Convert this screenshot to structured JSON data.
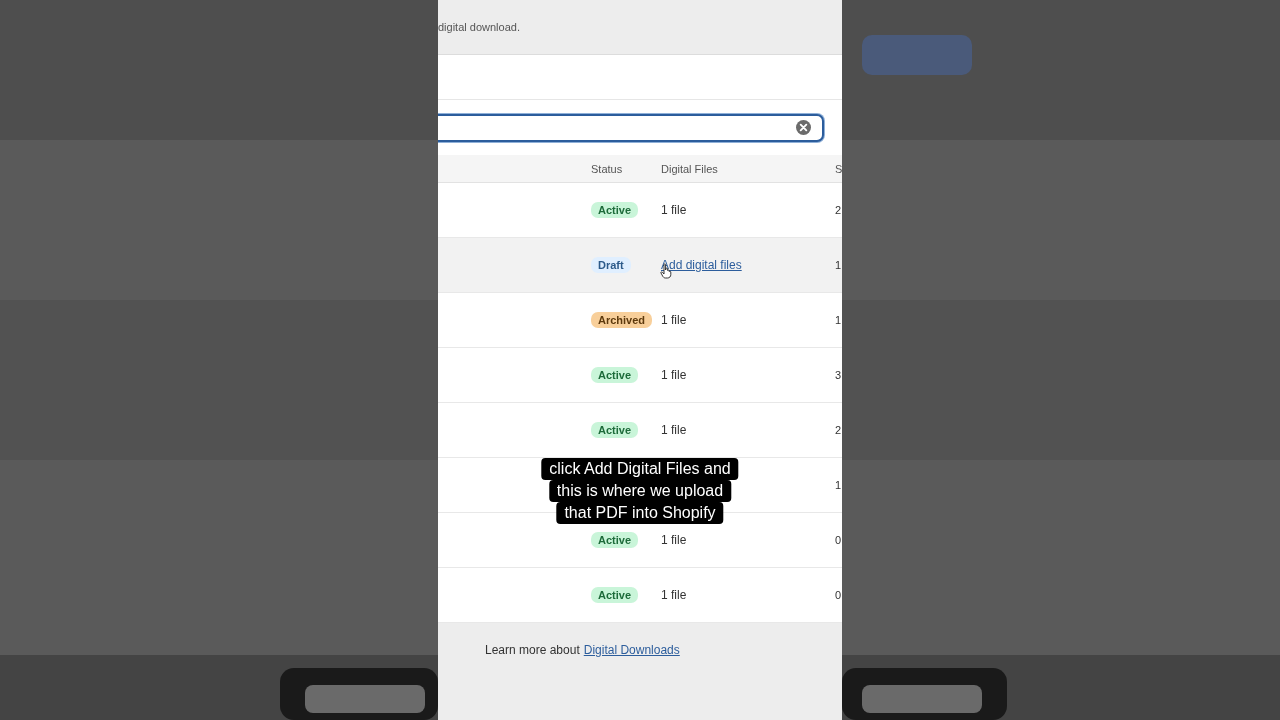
{
  "intro": {
    "text": "digital download."
  },
  "table": {
    "columns": [
      "Status",
      "Digital Files",
      "S"
    ],
    "rows": [
      {
        "status": {
          "label": "Active",
          "kind": "active"
        },
        "files": {
          "text": "1 file",
          "kind": "count"
        },
        "column_3": "2",
        "hovered": false
      },
      {
        "status": {
          "label": "Draft",
          "kind": "draft"
        },
        "files": {
          "text": "Add digital files",
          "kind": "link"
        },
        "column_3": "1",
        "hovered": true
      },
      {
        "status": {
          "label": "Archived",
          "kind": "archived"
        },
        "files": {
          "text": "1 file",
          "kind": "count"
        },
        "column_3": "1",
        "hovered": false
      },
      {
        "status": {
          "label": "Active",
          "kind": "active"
        },
        "files": {
          "text": "1 file",
          "kind": "count"
        },
        "column_3": "3",
        "hovered": false
      },
      {
        "status": {
          "label": "Active",
          "kind": "active"
        },
        "files": {
          "text": "1 file",
          "kind": "count"
        },
        "column_3": "2",
        "hovered": false
      },
      {
        "column_3": "1",
        "hovered": false
      },
      {
        "status": {
          "label": "Active",
          "kind": "active"
        },
        "files": {
          "text": "1 file",
          "kind": "count"
        },
        "column_3": "0",
        "hovered": false
      },
      {
        "status": {
          "label": "Active",
          "kind": "active"
        },
        "files": {
          "text": "1 file",
          "kind": "count"
        },
        "column_3": "0",
        "hovered": false
      }
    ]
  },
  "footer": {
    "text": "Learn more about",
    "link": "Digital Downloads"
  },
  "caption": [
    "click Add Digital Files and",
    "this is where we upload",
    "that PDF into Shopify"
  ]
}
